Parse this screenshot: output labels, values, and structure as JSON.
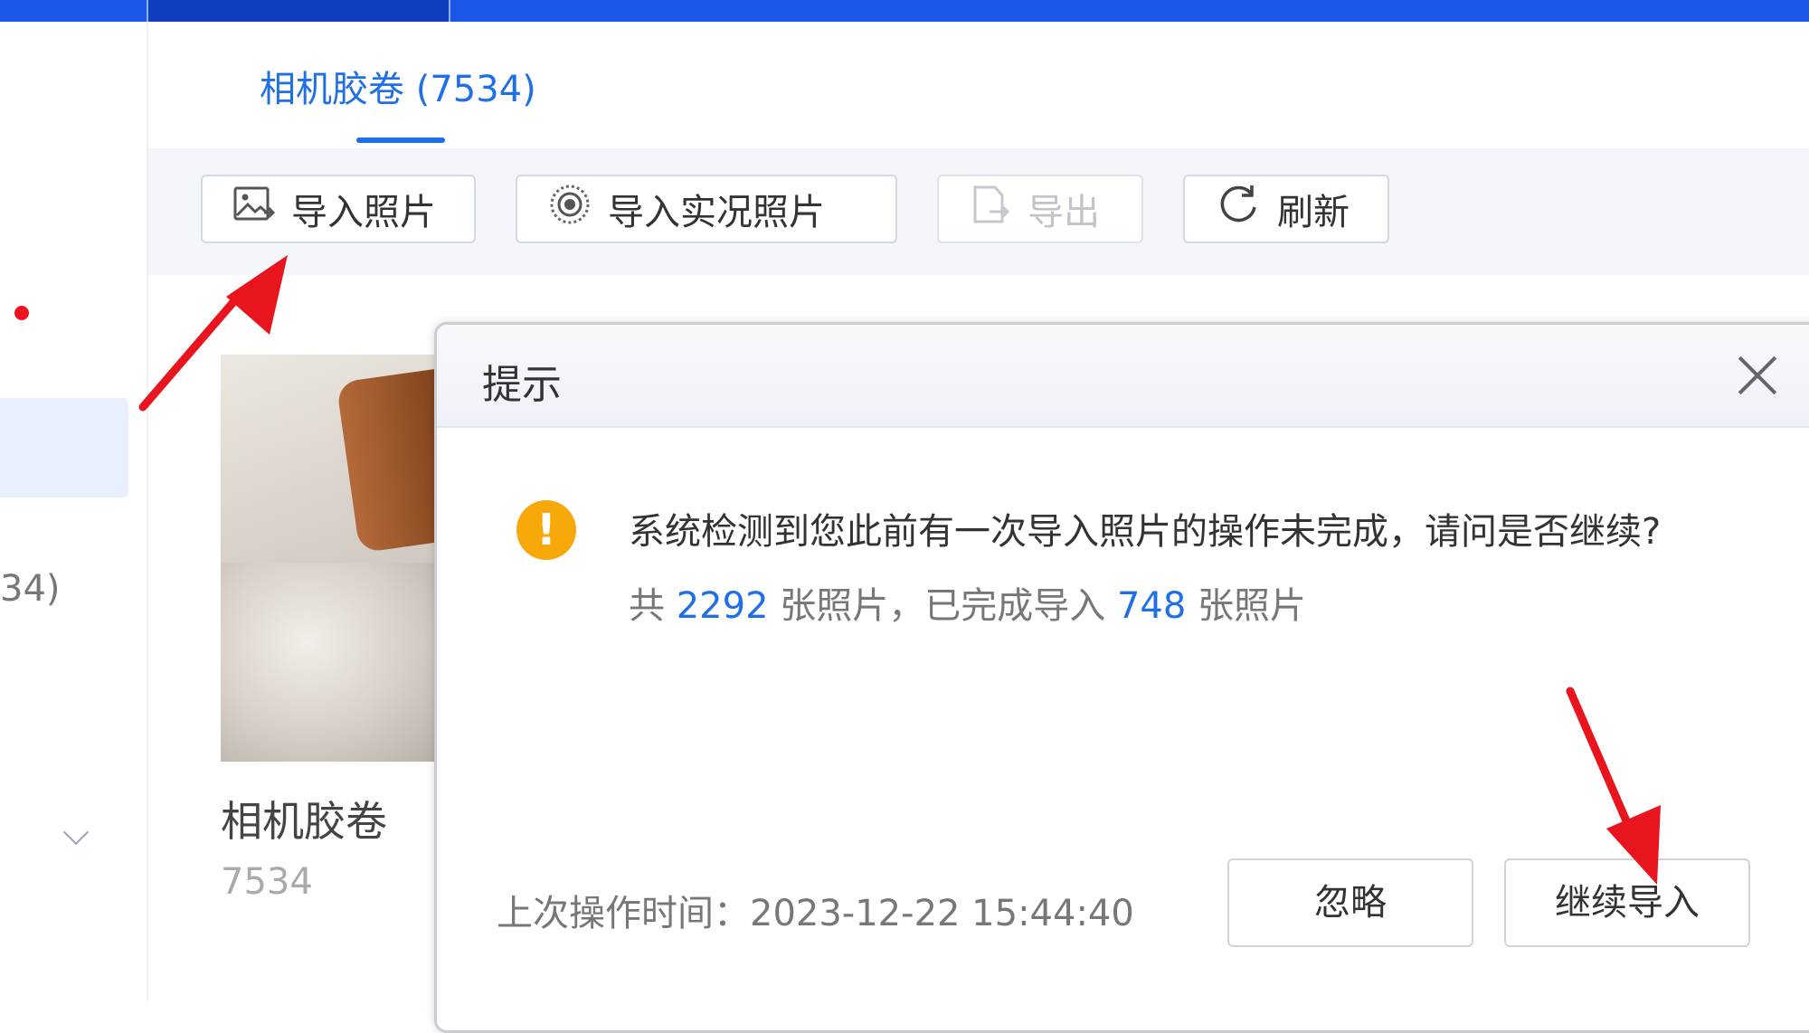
{
  "tab": {
    "label": "相机胶卷 (7534)"
  },
  "sidebar": {
    "partial_count": "34)"
  },
  "toolbar": {
    "import_photos": "导入照片",
    "import_live_photos": "导入实况照片",
    "export": "导出",
    "refresh": "刷新"
  },
  "album": {
    "title": "相机胶卷",
    "count": "7534"
  },
  "dialog": {
    "title": "提示",
    "message": "系统检测到您此前有一次导入照片的操作未完成，请问是否继续?",
    "sub_prefix": "共",
    "total": "2292",
    "sub_middle": "张照片，已完成导入",
    "done": "748",
    "sub_suffix": "张照片",
    "last_time_label": "上次操作时间：",
    "last_time": "2023-12-22 15:44:40",
    "ignore_button": "忽略",
    "continue_button": "继续导入"
  },
  "colors": {
    "accent": "#1f6fe6",
    "topbar": "#1a56e8",
    "warning": "#f7a90a",
    "annotation": "#e8141e"
  },
  "icons": [
    "image-import-icon",
    "live-photo-icon",
    "export-icon",
    "refresh-icon",
    "warning-icon",
    "close-icon",
    "chevron-down-icon"
  ]
}
